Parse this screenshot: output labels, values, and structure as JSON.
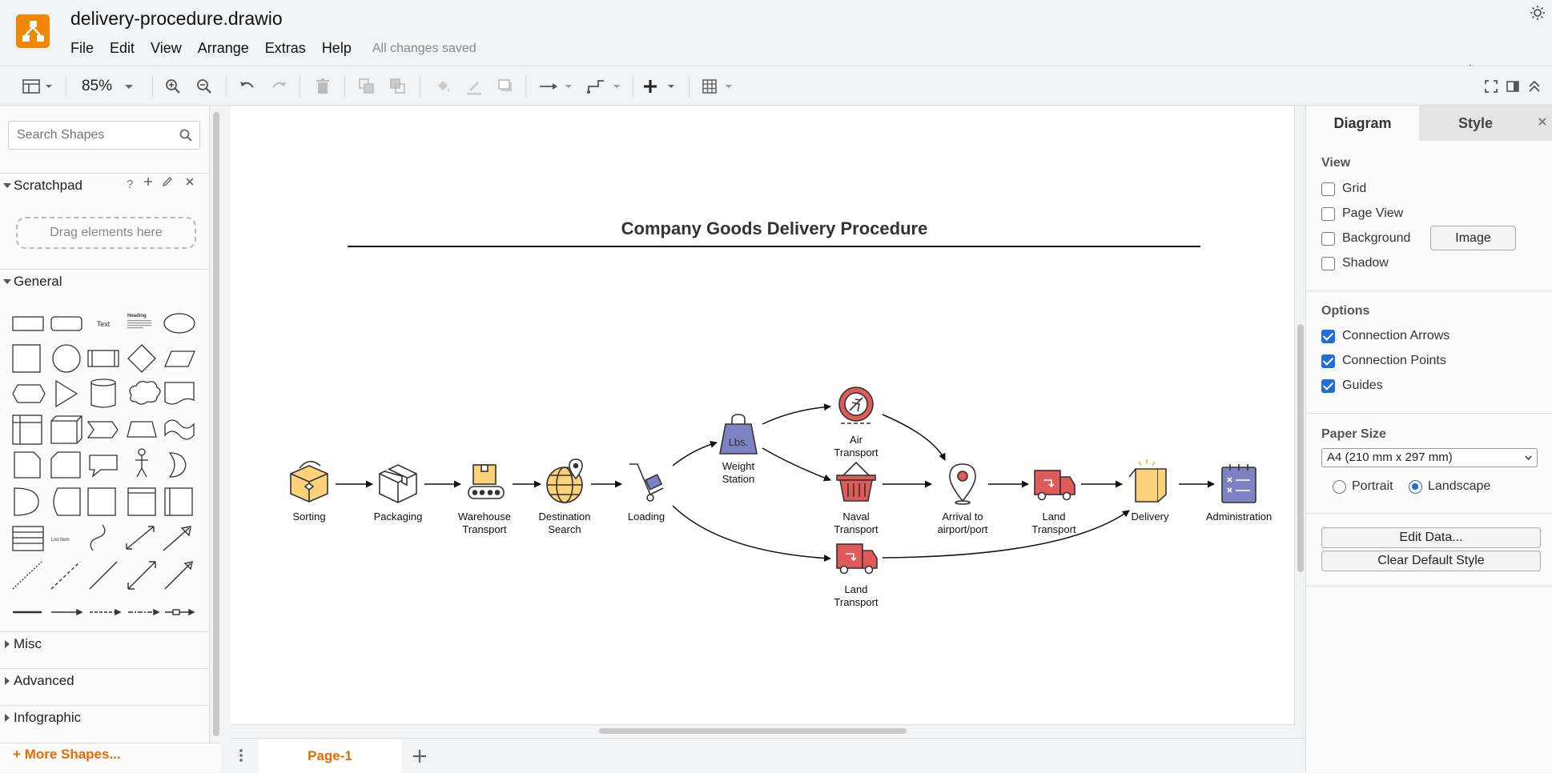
{
  "app": {
    "file_title": "delivery-procedure.drawio",
    "menus": [
      "File",
      "Edit",
      "View",
      "Arrange",
      "Extras",
      "Help"
    ],
    "save_status": "All changes saved"
  },
  "toolbar": {
    "zoom": "85%",
    "icons": [
      "format-panel-icon",
      "zoom-in-icon",
      "zoom-out-icon",
      "undo-icon",
      "redo-icon",
      "delete-icon",
      "to-front-icon",
      "to-back-icon",
      "fill-color-icon",
      "line-color-icon",
      "shadow-icon",
      "connection-icon",
      "waypoints-icon",
      "insert-icon",
      "table-icon",
      "fullscreen-icon",
      "toggle-panel-icon",
      "collapse-icon"
    ]
  },
  "sidebar": {
    "search_placeholder": "Search Shapes",
    "scratchpad_title": "Scratchpad",
    "scratchpad_help": "?",
    "drag_hint": "Drag elements here",
    "general_title": "General",
    "shape_text": "Text",
    "shape_heading": "Heading",
    "shape_list_item": "List Item",
    "collapsed_sections": [
      "Misc",
      "Advanced",
      "Infographic"
    ],
    "more_shapes": "More Shapes..."
  },
  "diagram": {
    "title": "Company Goods Delivery Procedure",
    "nodes": {
      "sorting": "Sorting",
      "packaging": "Packaging",
      "warehouse_1": "Warehouse",
      "warehouse_2": "Transport",
      "destination_1": "Destination",
      "destination_2": "Search",
      "loading": "Loading",
      "weight_1": "Weight",
      "weight_2": "Station",
      "weight_icon_text": "Lbs.",
      "air_1": "Air",
      "air_2": "Transport",
      "naval_1": "Naval",
      "naval_2": "Transport",
      "land_bottom_1": "Land",
      "land_bottom_2": "Transport",
      "arrival_1": "Arrival to",
      "arrival_2": "airport/port",
      "land_1": "Land",
      "land_2": "Transport",
      "delivery": "Delivery",
      "administration": "Administration"
    }
  },
  "pages": {
    "current": "Page-1"
  },
  "format_panel": {
    "tabs": [
      "Diagram",
      "Style"
    ],
    "view_title": "View",
    "view_options": [
      {
        "label": "Grid",
        "checked": false
      },
      {
        "label": "Page View",
        "checked": false
      },
      {
        "label": "Background",
        "checked": false
      },
      {
        "label": "Shadow",
        "checked": false
      }
    ],
    "image_button": "Image",
    "options_title": "Options",
    "options": [
      {
        "label": "Connection Arrows",
        "checked": true
      },
      {
        "label": "Connection Points",
        "checked": true
      },
      {
        "label": "Guides",
        "checked": true
      }
    ],
    "paper_size_title": "Paper Size",
    "paper_size_value": "A4 (210 mm x 297 mm)",
    "orientation": [
      {
        "label": "Portrait",
        "selected": false
      },
      {
        "label": "Landscape",
        "selected": true
      }
    ],
    "edit_data_button": "Edit Data...",
    "clear_style_button": "Clear Default Style"
  },
  "colors": {
    "accent": "#e66c00",
    "logo": "#f08705",
    "checkbox": "#1f6fd6",
    "icon_yellow": "#fbd17a",
    "icon_red": "#e05a5a",
    "icon_purple": "#7c82c2"
  }
}
